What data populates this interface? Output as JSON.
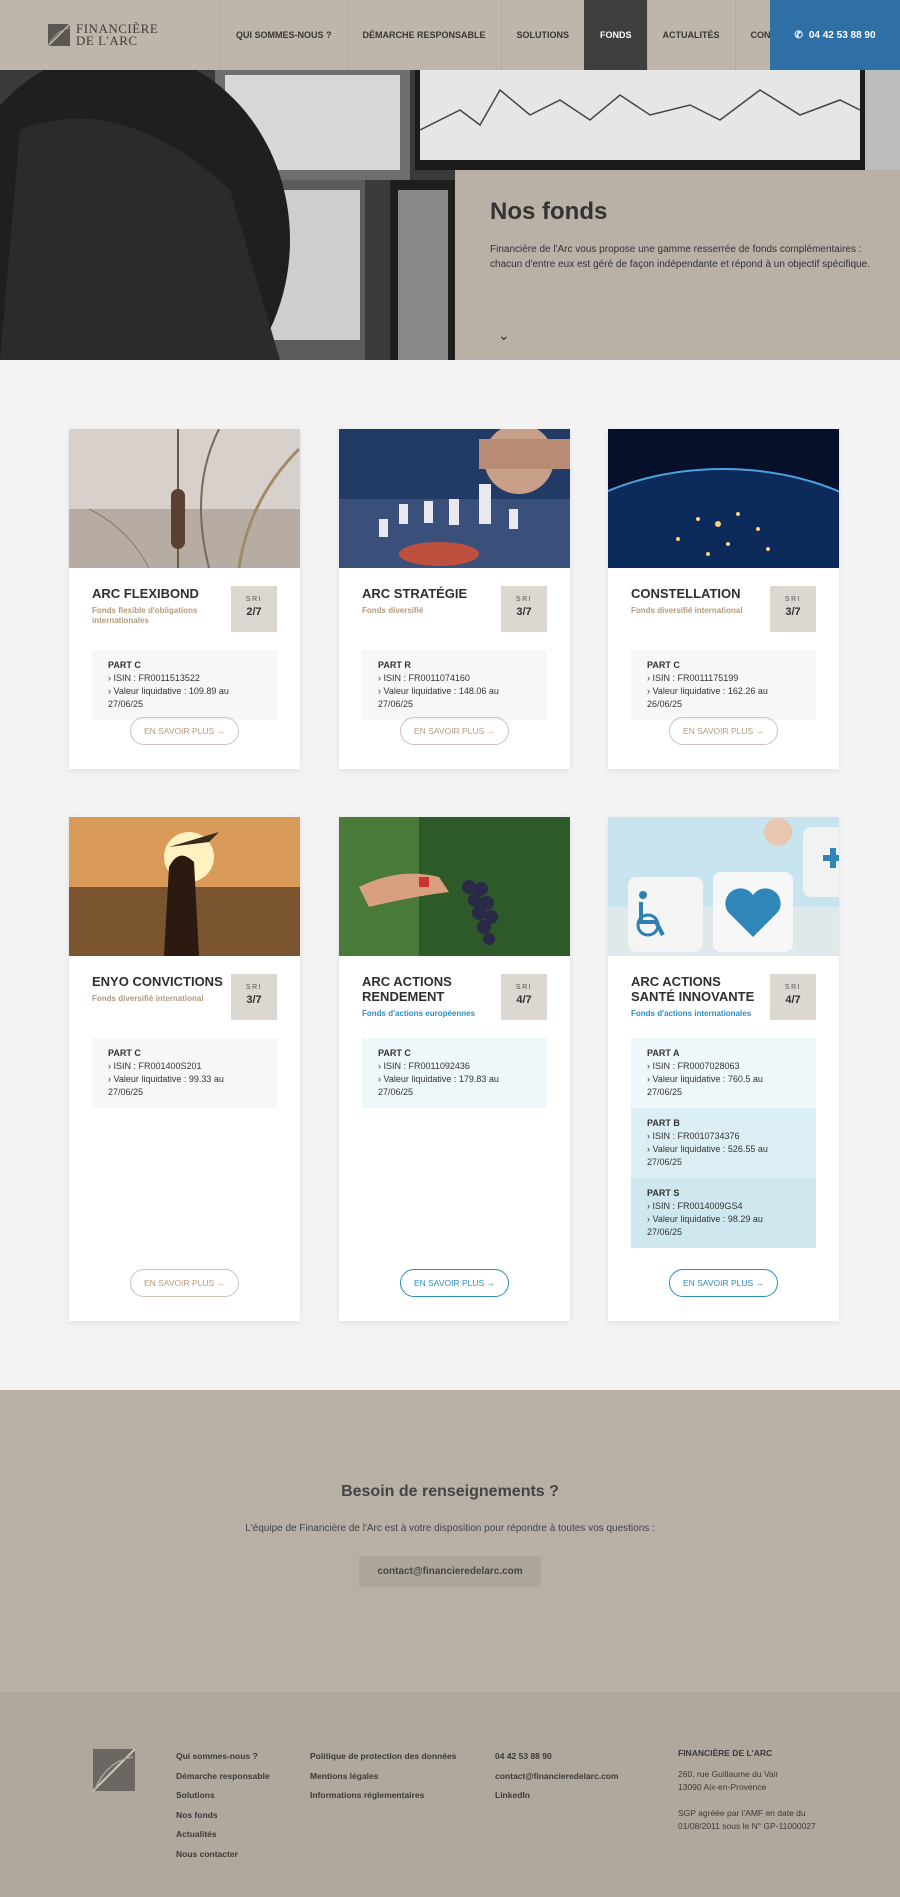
{
  "header": {
    "logo_line1": "FINANCIÈRE",
    "logo_line2": "DE L'ARC",
    "nav": [
      "QUI SOMMES-NOUS ?",
      "DÉMARCHE RESPONSABLE",
      "SOLUTIONS",
      "FONDS",
      "ACTUALITÉS",
      "CONTACT"
    ],
    "active_nav": "FONDS",
    "phone": "04 42 53 88 90",
    "accent": "#2f6fa6"
  },
  "hero": {
    "title": "Nos fonds",
    "text": "Financière de l'Arc vous propose une gamme resserrée de fonds complémentaires : chacun d'entre eux est géré de façon indépendante et répond à un objectif spécifique.",
    "chevron": "⌄"
  },
  "cards": [
    {
      "title": "ARC FLEXIBOND",
      "subtitle": "Fonds flexible d'obligations internationales",
      "sri_label": "SRI",
      "sri": "2/7",
      "theme": "beige",
      "button": "EN SAVOIR PLUS →",
      "image": "cattail",
      "parts": [
        {
          "name": "PART C",
          "isin": "› ISIN : FR0011513522",
          "vl": "› Valeur liquidative : 109.89 au 27/06/25"
        }
      ]
    },
    {
      "title": "ARC STRATÉGIE",
      "subtitle": "Fonds diversifié",
      "sri_label": "SRI",
      "sri": "3/7",
      "theme": "beige",
      "button": "EN SAVOIR PLUS →",
      "image": "chess",
      "parts": [
        {
          "name": "PART R",
          "isin": "› ISIN : FR0011074160",
          "vl": "› Valeur liquidative : 148.06 au 27/06/25"
        }
      ]
    },
    {
      "title": "CONSTELLATION",
      "subtitle": "Fonds diversifié international",
      "sri_label": "SRI",
      "sri": "3/7",
      "theme": "beige",
      "button": "EN SAVOIR PLUS →",
      "image": "earth",
      "parts": [
        {
          "name": "PART C",
          "isin": "› ISIN : FR0011175199",
          "vl": "› Valeur liquidative : 162.26 au 26/06/25"
        }
      ]
    },
    {
      "title": "ENYO CONVICTIONS",
      "subtitle": "Fonds diversifié international",
      "sri_label": "SRI",
      "sri": "3/7",
      "theme": "beige",
      "button": "EN SAVOIR PLUS →",
      "image": "sunset",
      "parts": [
        {
          "name": "PART C",
          "isin": "› ISIN : FR001400S201",
          "vl": "› Valeur liquidative : 99.33 au 27/06/25"
        }
      ]
    },
    {
      "title": "ARC ACTIONS RENDEMENT",
      "subtitle": "Fonds d'actions européennes",
      "sri_label": "SRI",
      "sri": "4/7",
      "theme": "blue",
      "button": "EN SAVOIR PLUS →",
      "image": "grapes",
      "parts": [
        {
          "name": "PART C",
          "isin": "› ISIN : FR0011092436",
          "vl": "› Valeur liquidative : 179.83 au 27/06/25"
        }
      ]
    },
    {
      "title": "ARC ACTIONS SANTÉ INNOVANTE",
      "subtitle": "Fonds d'actions internationales",
      "sri_label": "SRI",
      "sri": "4/7",
      "theme": "blue",
      "button": "EN SAVOIR PLUS →",
      "image": "health",
      "parts": [
        {
          "name": "PART A",
          "isin": "› ISIN : FR0007028063",
          "vl": "› Valeur liquidative : 760.5 au 27/06/25"
        },
        {
          "name": "PART B",
          "isin": "› ISIN : FR0010734376",
          "vl": "› Valeur liquidative : 526.55 au 27/06/25"
        },
        {
          "name": "PART S",
          "isin": "› ISIN : FR0014009GS4",
          "vl": "› Valeur liquidative : 98.29 au 27/06/25"
        }
      ]
    }
  ],
  "contact": {
    "title": "Besoin de renseignements ?",
    "text": "L'équipe de Financière de l'Arc est à votre disposition pour répondre à toutes vos questions :",
    "email": "contact@financieredelarc.com"
  },
  "footer": {
    "col1": [
      "Qui sommes-nous ?",
      "Démarche responsable",
      "Solutions",
      "Nos fonds",
      "Actualités",
      "Nous contacter"
    ],
    "col2": [
      "Politique de protection des données",
      "Mentions légales",
      "Informations réglementaires"
    ],
    "col3": [
      "04 42 53 88 90",
      "contact@financieredelarc.com",
      "LinkedIn"
    ],
    "company": "FINANCIÈRE DE L'ARC",
    "address1": "260, rue Guillaume du Vair",
    "address2": "13090 Aix-en-Provence",
    "sgp": "SGP agréée par l'AMF en date du 01/08/2011 sous le N° GP-11000027"
  }
}
